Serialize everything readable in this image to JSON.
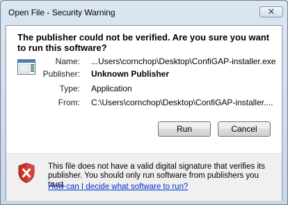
{
  "window": {
    "title": "Open File - Security Warning",
    "close_glyph": "✕"
  },
  "heading": "The publisher could not be verified.  Are you sure you want to run this software?",
  "details": {
    "name_label": "Name:",
    "name_value": "...Users\\cornchop\\Desktop\\ConfiGAP-installer.exe",
    "publisher_label": "Publisher:",
    "publisher_value": "Unknown Publisher",
    "type_label": "Type:",
    "type_value": "Application",
    "from_label": "From:",
    "from_value": "C:\\Users\\cornchop\\Desktop\\ConfiGAP-installer...."
  },
  "buttons": {
    "run": "Run",
    "cancel": "Cancel"
  },
  "footer": {
    "warning_text": "This file does not have a valid digital signature that verifies its publisher.  You should only run software from publishers you trust.",
    "help_link": "How can I decide what software to run?"
  },
  "icons": {
    "file": "application-file-icon",
    "shield": "security-shield-icon"
  },
  "colors": {
    "shield_red": "#c8302a",
    "link": "#0033cc"
  }
}
